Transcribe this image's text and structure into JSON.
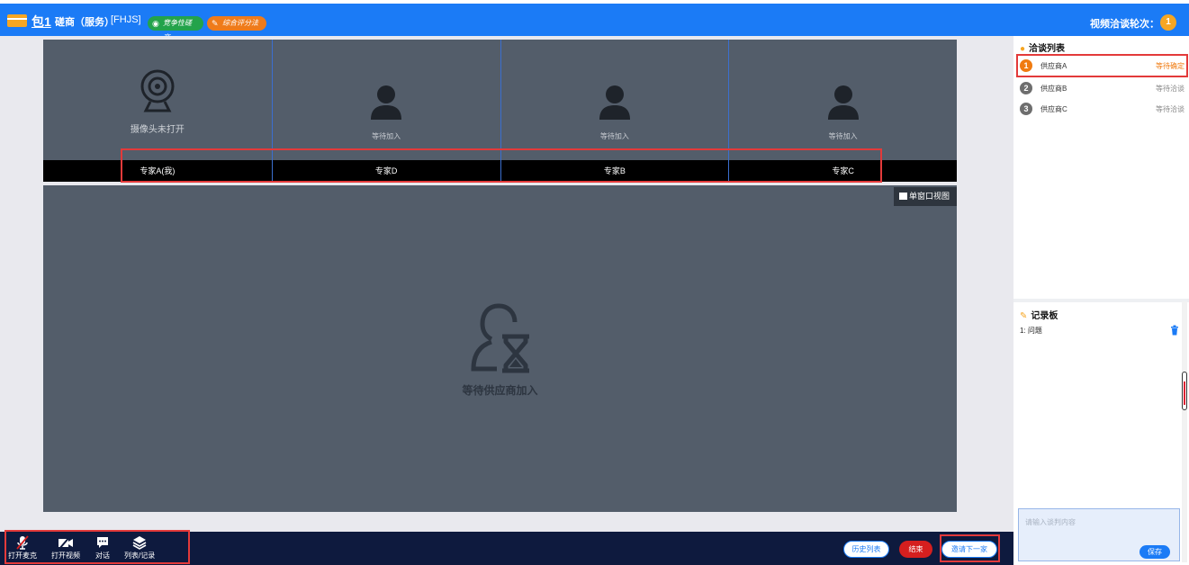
{
  "header": {
    "package_label": "包1",
    "project_title": "磋商（服务）",
    "project_code": "[FHJS]",
    "tag_competitive": "竞争性磋商",
    "tag_scoring": "综合评分法",
    "rounds_label": "视频洽谈轮次：",
    "rounds_value": "1"
  },
  "experts": [
    {
      "name": "专家A(我)",
      "status": "摄像头未打开"
    },
    {
      "name": "专家D",
      "status": "等待加入"
    },
    {
      "name": "专家B",
      "status": "等待加入"
    },
    {
      "name": "专家C",
      "status": "等待加入"
    }
  ],
  "main_video": {
    "single_view_label": "单窗口视图",
    "waiting_text": "等待供应商加入"
  },
  "controls": {
    "mic_label": "打开麦克",
    "video_label": "打开视频",
    "chat_label": "对话",
    "records_label": "列表/记录",
    "history_button": "历史列表",
    "end_button": "结束",
    "invite_button": "邀请下一家"
  },
  "negotiation_list": {
    "title": "洽谈列表",
    "items": [
      {
        "num": "1",
        "name": "供应商A",
        "status": "等待确定"
      },
      {
        "num": "2",
        "name": "供应商B",
        "status": "等待洽谈"
      },
      {
        "num": "3",
        "name": "供应商C",
        "status": "等待洽谈"
      }
    ]
  },
  "notes": {
    "title": "记录板",
    "items": [
      "1: 问题"
    ],
    "placeholder": "请输入谈判内容",
    "save_button": "保存"
  },
  "colors": {
    "primary": "#1b7bf6",
    "video_bg": "#535d6a",
    "bottom_bar": "#0e1a3e",
    "accent_orange": "#f07b10",
    "danger": "#d51f1f",
    "highlight": "#e33a3a"
  }
}
